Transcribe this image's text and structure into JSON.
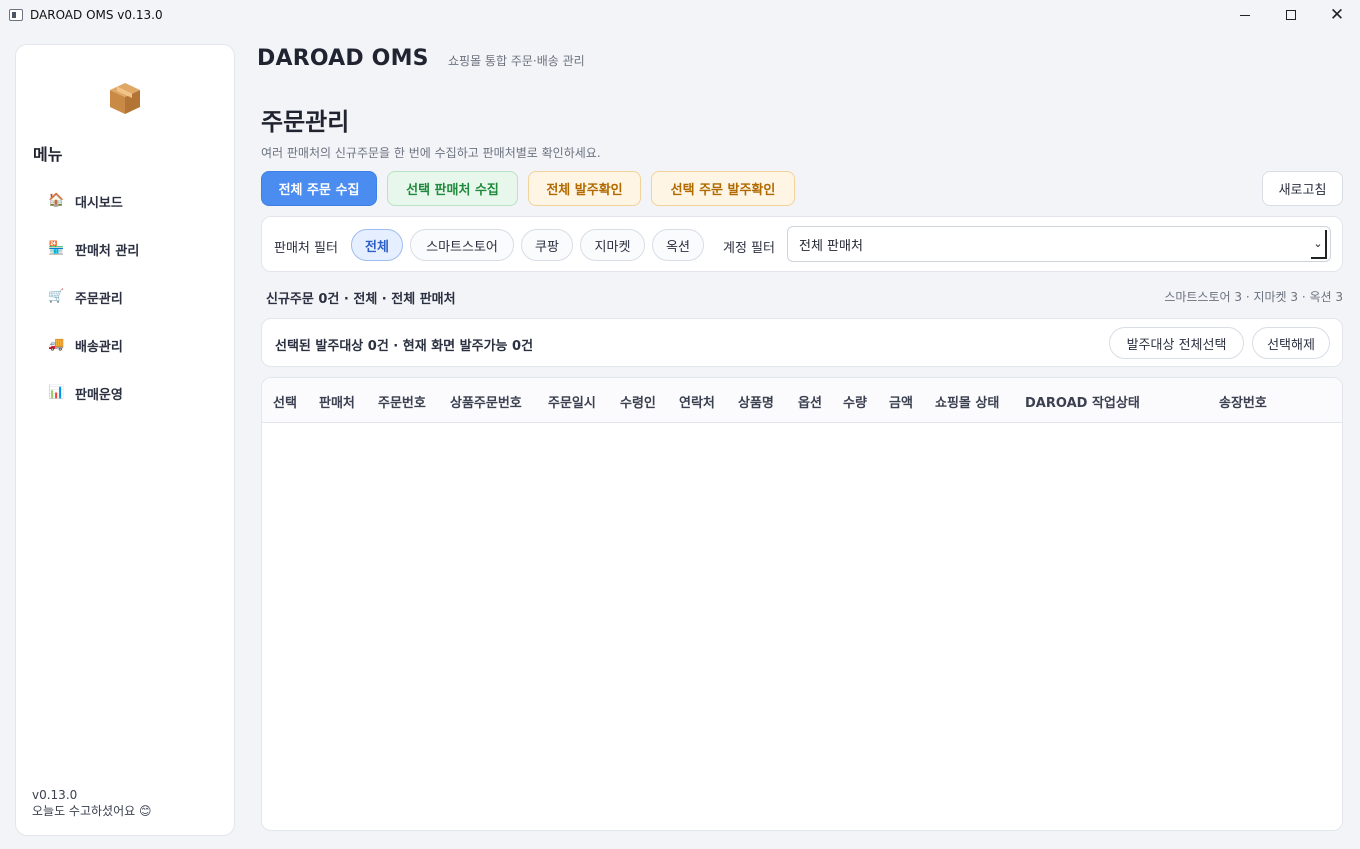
{
  "window": {
    "title": "DAROAD OMS v0.13.0"
  },
  "sidebar": {
    "menu_title": "메뉴",
    "items": [
      {
        "label": "대시보드",
        "icon": "🏠"
      },
      {
        "label": "판매처 관리",
        "icon": "🏪"
      },
      {
        "label": "주문관리",
        "icon": "🛒"
      },
      {
        "label": "배송관리",
        "icon": "🚚"
      },
      {
        "label": "판매운영",
        "icon": "📊"
      }
    ],
    "version": "v0.13.0",
    "greeting": "오늘도 수고하셨어요 😊"
  },
  "header": {
    "app_name": "DAROAD OMS",
    "subtitle": "쇼핑몰 통합 주문·배송 관리"
  },
  "page": {
    "title": "주문관리",
    "description": "여러 판매처의 신규주문을 한 번에 수집하고 판매처별로 확인하세요."
  },
  "actions": {
    "collect_all": "전체 주문 수집",
    "collect_selected_vendor": "선택 판매처 수집",
    "confirm_all": "전체 발주확인",
    "confirm_selected": "선택 주문 발주확인",
    "refresh": "새로고침"
  },
  "filters": {
    "vendor_label": "판매처 필터",
    "chips": [
      "전체",
      "스마트스토어",
      "쿠팡",
      "지마켓",
      "옥션"
    ],
    "active_chip": "전체",
    "account_label": "계정 필터",
    "account_value": "전체 판매처"
  },
  "summary": {
    "left": "신규주문 0건 · 전체 · 전체 판매처",
    "right": "스마트스토어 3 · 지마켓 3 · 옥션 3"
  },
  "selection": {
    "text": "선택된 발주대상 0건 · 현재 화면 발주가능 0건",
    "select_all": "발주대상 전체선택",
    "clear": "선택해제"
  },
  "table": {
    "columns": [
      "선택",
      "판매처",
      "주문번호",
      "상품주문번호",
      "주문일시",
      "수령인",
      "연락처",
      "상품명",
      "옵션",
      "수량",
      "금액",
      "쇼핑몰 상태",
      "DAROAD 작업상태",
      "송장번호"
    ],
    "rows": []
  }
}
